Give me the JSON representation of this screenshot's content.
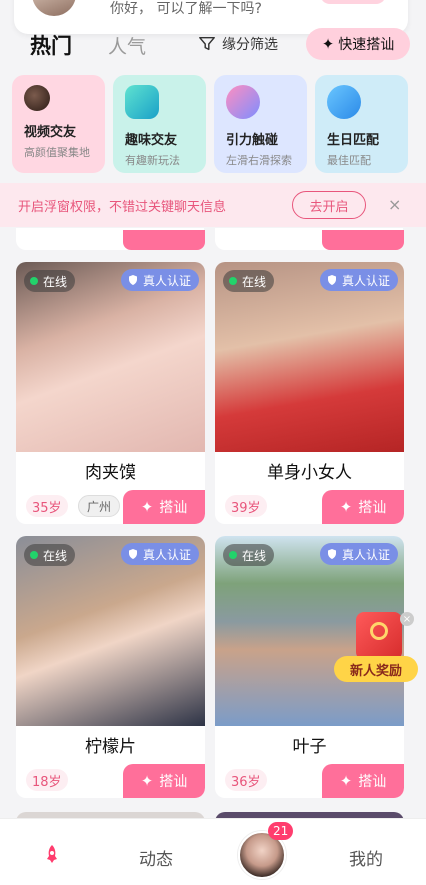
{
  "message_popup": {
    "text": "你好， 可以了解一下吗?"
  },
  "tabs": {
    "hot": "热门",
    "popular": "人气"
  },
  "filter": {
    "label": "缘分筛选",
    "icon": "funnel-heart-icon"
  },
  "quick_chat": {
    "label": "快速搭讪",
    "icon": "sparkle-icon"
  },
  "features": [
    {
      "title": "视频交友",
      "subtitle": "高颜值聚集地",
      "icon": "avatar-pair-icon"
    },
    {
      "title": "趣味交友",
      "subtitle": "有趣新玩法",
      "icon": "question-cube-icon"
    },
    {
      "title": "引力触碰",
      "subtitle": "左滑右滑探索",
      "icon": "hearts-icon"
    },
    {
      "title": "生日匹配",
      "subtitle": "最佳匹配",
      "icon": "birthday-planet-icon"
    }
  ],
  "banner": {
    "text": "开启浮窗权限，不错过关键聊天信息",
    "button": "去开启",
    "close": "×"
  },
  "cards": [
    {
      "status": "在线",
      "verified": "真人认证",
      "name": "肉夹馍",
      "age": "35岁",
      "city": "广州",
      "action": "搭讪"
    },
    {
      "status": "在线",
      "verified": "真人认证",
      "name": "单身小女人",
      "age": "39岁",
      "city": "",
      "action": "搭讪"
    },
    {
      "status": "在线",
      "verified": "真人认证",
      "name": "柠檬片",
      "age": "18岁",
      "city": "",
      "action": "搭讪"
    },
    {
      "status": "在线",
      "verified": "真人认证",
      "name": "叶子",
      "age": "36岁",
      "city": "",
      "action": "搭讪"
    }
  ],
  "reward": {
    "label": "新人奖励"
  },
  "bottom_nav": {
    "dynamic": "动态",
    "mine": "我的",
    "badge": "21"
  },
  "colors": {
    "accent": "#ff6f9a",
    "accent_text": "#e8567c",
    "online": "#22d36b",
    "verified": "#7a8fe6"
  }
}
